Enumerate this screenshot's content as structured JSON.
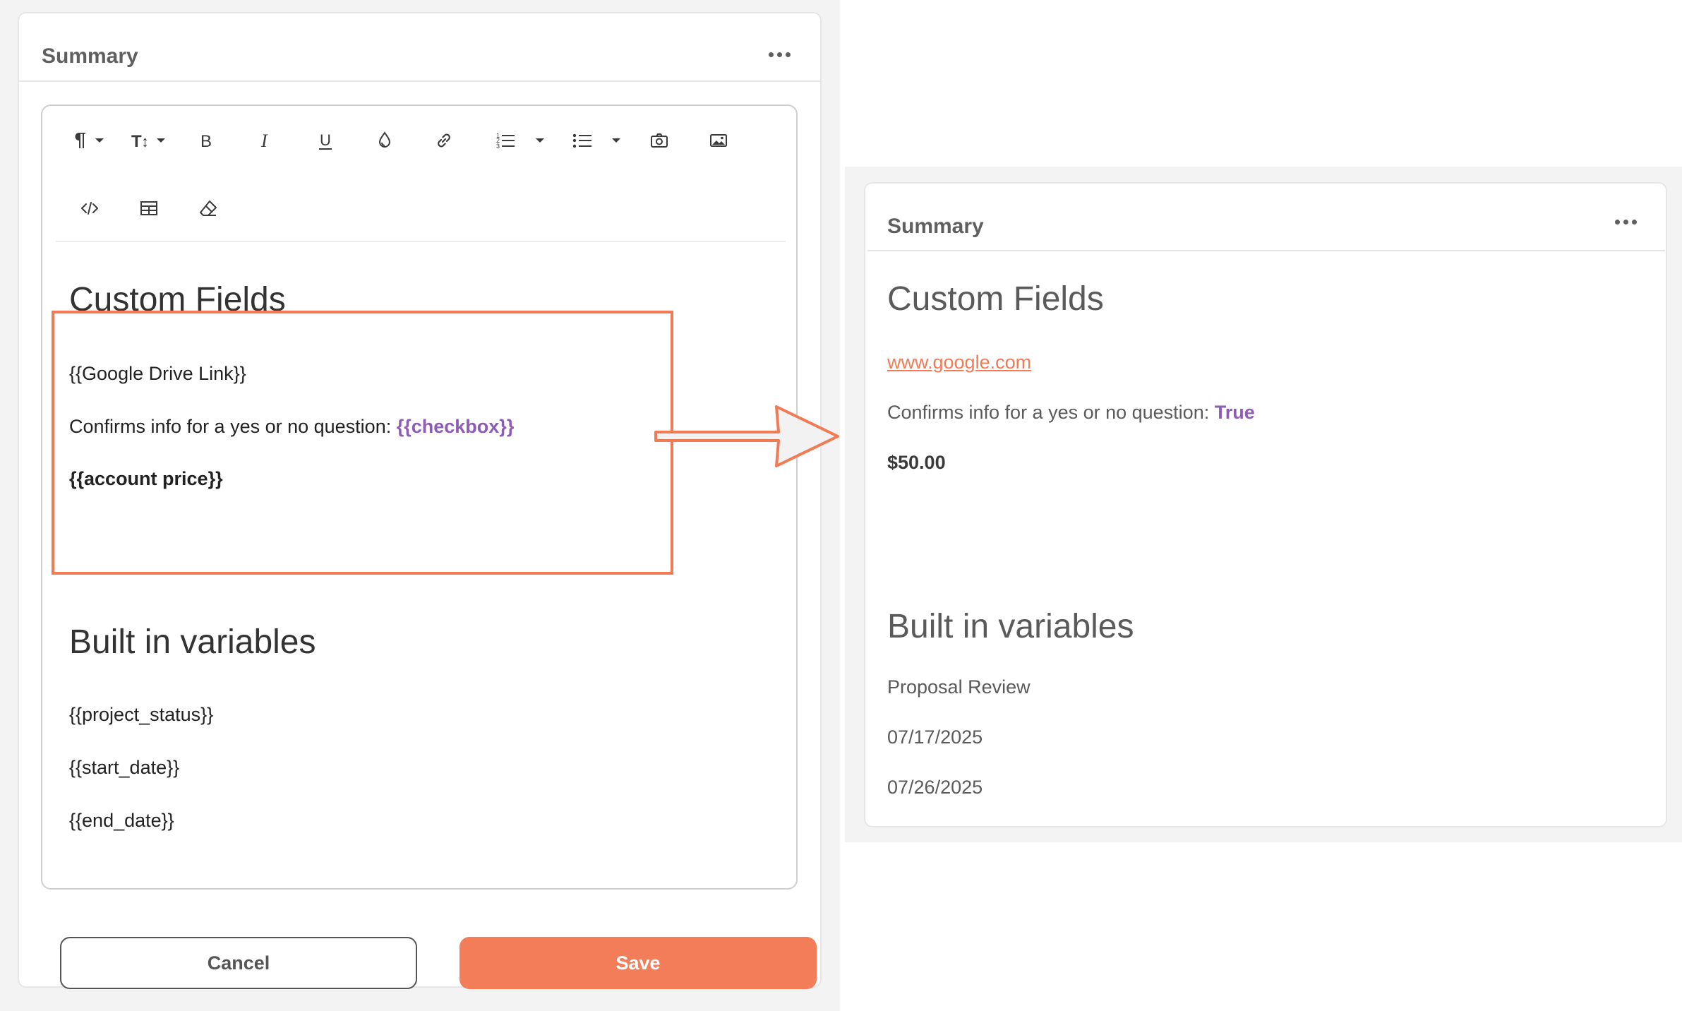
{
  "editor_card": {
    "title": "Summary",
    "custom_fields_heading": "Custom Fields",
    "google_drive_link": "{{Google Drive Link}}",
    "confirm_text": "Confirms info for a yes or no question:",
    "checkbox_var": "{{checkbox}}",
    "account_price": "{{account price}}",
    "builtin_heading": "Built in variables",
    "project_status": "{{project_status}}",
    "start_date": "{{start_date}}",
    "end_date": "{{end_date}}",
    "cancel_label": "Cancel",
    "save_label": "Save"
  },
  "toolbar": [
    "paragraph-format-icon",
    "text-size-icon",
    "bold-icon",
    "italic-icon",
    "underline-icon",
    "text-color-icon",
    "link-icon",
    "ordered-list-icon",
    "unordered-list-icon",
    "insert-image-icon",
    "image-manager-icon",
    "code-view-icon",
    "insert-table-icon",
    "clear-formatting-icon"
  ],
  "preview_card": {
    "title": "Summary",
    "custom_fields_heading": "Custom Fields",
    "link_value": "www.google.com",
    "confirm_text": "Confirms info for a yes or no question:",
    "checkbox_value": "True",
    "account_price_value": "$50.00",
    "builtin_heading": "Built in variables",
    "project_status_value": "Proposal Review",
    "start_date_value": "07/17/2025",
    "end_date_value": "07/26/2025"
  },
  "colors": {
    "accent": "#f47d59",
    "highlight_border": "#f07b55",
    "variable_purple": "#8e5bb6"
  }
}
